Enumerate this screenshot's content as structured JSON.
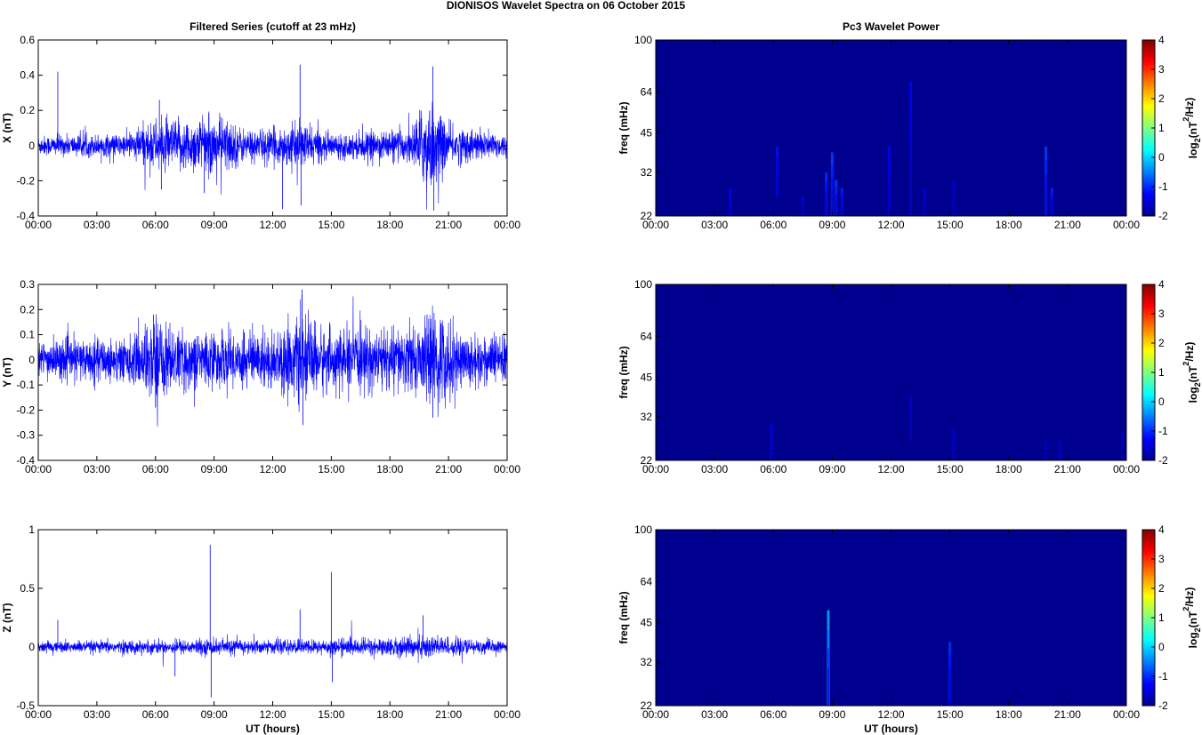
{
  "chart_data": {
    "title": "DIONISOS Wavelet Spectra on 06 October   2015",
    "xticks": [
      "00:00",
      "03:00",
      "06:00",
      "09:00",
      "12:00",
      "15:00",
      "18:00",
      "21:00",
      "00:00"
    ],
    "xlabel": "UT (hours)",
    "series_panels": [
      {
        "type": "line",
        "title": "Filtered Series (cutoff at 23 mHz)",
        "ylabel": "X (nT)",
        "ylim": [
          -0.4,
          0.6
        ],
        "yticks": [
          "-0.4",
          "-0.2",
          "0",
          "0.2",
          "0.4",
          "0.6"
        ],
        "yvals": [
          -0.4,
          -0.2,
          0,
          0.2,
          0.4,
          0.6
        ],
        "color": "#0000ff",
        "envelope": [
          [
            0,
            0.03
          ],
          [
            4.5,
            0.035
          ],
          [
            5.5,
            0.07
          ],
          [
            9.5,
            0.09
          ],
          [
            10.5,
            0.05
          ],
          [
            12,
            0.05
          ],
          [
            13.5,
            0.07
          ],
          [
            15,
            0.035
          ],
          [
            19,
            0.05
          ],
          [
            20,
            0.15
          ],
          [
            21,
            0.06
          ],
          [
            24,
            0.035
          ]
        ],
        "spikes": [
          [
            1.0,
            0.42
          ],
          [
            6.2,
            0.26
          ],
          [
            6.3,
            -0.25
          ],
          [
            8.5,
            -0.27
          ],
          [
            12.5,
            -0.36
          ],
          [
            13.4,
            0.46
          ],
          [
            13.45,
            -0.34
          ],
          [
            20.2,
            0.45
          ],
          [
            20.25,
            -0.37
          ],
          [
            24,
            0.2
          ]
        ]
      },
      {
        "type": "line",
        "title": "",
        "ylabel": "Y (nT)",
        "ylim": [
          -0.4,
          0.3
        ],
        "yticks": [
          "-0.4",
          "-0.3",
          "-0.2",
          "-0.1",
          "0",
          "0.1",
          "0.2",
          "0.3"
        ],
        "yvals": [
          -0.4,
          -0.3,
          -0.2,
          -0.1,
          0,
          0.1,
          0.2,
          0.3
        ],
        "color": "#0000ff",
        "envelope": [
          [
            0,
            0.04
          ],
          [
            5,
            0.05
          ],
          [
            6,
            0.1
          ],
          [
            7,
            0.06
          ],
          [
            12,
            0.06
          ],
          [
            13.5,
            0.09
          ],
          [
            15,
            0.06
          ],
          [
            19.5,
            0.07
          ],
          [
            20.5,
            0.11
          ],
          [
            21.5,
            0.06
          ],
          [
            24,
            0.05
          ]
        ],
        "spikes": [
          [
            5.9,
            0.18
          ],
          [
            6.0,
            -0.19
          ],
          [
            13.5,
            0.28
          ],
          [
            13.55,
            -0.26
          ],
          [
            20.2,
            -0.23
          ],
          [
            19.9,
            0.18
          ],
          [
            24,
            0.12
          ]
        ]
      },
      {
        "type": "line",
        "title": "",
        "ylabel": "Z (nT)",
        "ylim": [
          -0.5,
          1
        ],
        "yticks": [
          "-0.5",
          "0",
          "0.5",
          "1"
        ],
        "yvals": [
          -0.5,
          0,
          0.5,
          1
        ],
        "color": "#0000ff",
        "envelope": [
          [
            0,
            0.025
          ],
          [
            6,
            0.03
          ],
          [
            9,
            0.035
          ],
          [
            12,
            0.03
          ],
          [
            18,
            0.04
          ],
          [
            20,
            0.06
          ],
          [
            21,
            0.04
          ],
          [
            24,
            0.025
          ]
        ],
        "spikes": [
          [
            1.0,
            0.23
          ],
          [
            7.0,
            -0.25
          ],
          [
            8.8,
            0.87
          ],
          [
            8.85,
            -0.43
          ],
          [
            13.4,
            0.32
          ],
          [
            15.0,
            0.64
          ],
          [
            15.05,
            -0.3
          ],
          [
            19.7,
            0.27
          ]
        ]
      }
    ],
    "spectra_panels": [
      {
        "type": "heatmap",
        "title": "Pc3 Wavelet Power",
        "ylabel": "freq (mHz)",
        "ylim": [
          22,
          100
        ],
        "yticks": [
          "22",
          "32",
          "45",
          "64",
          "100"
        ],
        "yvals": [
          22,
          32,
          45,
          64,
          100
        ],
        "clim": [
          -2,
          4
        ],
        "cbar_ticks": [
          "-2",
          "-1",
          "0",
          "1",
          "2",
          "3",
          "4"
        ],
        "cbar_label": "log2(nT2/Hz)",
        "background": -2,
        "features": [
          [
            3.8,
            22,
            28,
            -1.3
          ],
          [
            6.2,
            26,
            40,
            -1.2
          ],
          [
            7.5,
            22,
            26,
            -1.4
          ],
          [
            8.7,
            22,
            32,
            -1.0
          ],
          [
            9.0,
            22,
            38,
            -0.9
          ],
          [
            9.2,
            22,
            30,
            -0.9
          ],
          [
            9.5,
            22,
            28,
            -1.1
          ],
          [
            11.9,
            22,
            40,
            -1.3
          ],
          [
            13.0,
            22,
            70,
            -1.3
          ],
          [
            13.7,
            22,
            28,
            -1.4
          ],
          [
            15.2,
            22,
            30,
            -1.5
          ],
          [
            19.9,
            22,
            40,
            -0.9
          ],
          [
            20.2,
            22,
            28,
            -1.1
          ]
        ]
      },
      {
        "type": "heatmap",
        "title": "",
        "ylabel": "freq (mHz)",
        "ylim": [
          22,
          100
        ],
        "yticks": [
          "22",
          "32",
          "45",
          "64",
          "100"
        ],
        "yvals": [
          22,
          32,
          45,
          64,
          100
        ],
        "clim": [
          -2,
          4
        ],
        "cbar_ticks": [
          "-2",
          "-1",
          "0",
          "1",
          "2",
          "3",
          "4"
        ],
        "cbar_label": "log2(nT2/Hz)",
        "background": -2,
        "features": [
          [
            5.9,
            22,
            30,
            -1.4
          ],
          [
            13.0,
            26,
            38,
            -1.5
          ],
          [
            15.2,
            22,
            29,
            -1.5
          ],
          [
            19.9,
            22,
            26,
            -1.6
          ],
          [
            20.6,
            22,
            26,
            -1.5
          ],
          [
            23.8,
            22,
            28,
            -1.6
          ]
        ]
      },
      {
        "type": "heatmap",
        "title": "",
        "ylabel": "freq (mHz)",
        "ylim": [
          22,
          100
        ],
        "yticks": [
          "22",
          "32",
          "45",
          "64",
          "100"
        ],
        "yvals": [
          22,
          32,
          45,
          64,
          100
        ],
        "clim": [
          -2,
          4
        ],
        "cbar_ticks": [
          "-2",
          "-1",
          "0",
          "1",
          "2",
          "3",
          "4"
        ],
        "cbar_label": "log2(nT2/Hz)",
        "background": -2,
        "features": [
          [
            8.8,
            22,
            50,
            -0.2
          ],
          [
            15.0,
            22,
            38,
            -1.0
          ]
        ]
      }
    ]
  }
}
